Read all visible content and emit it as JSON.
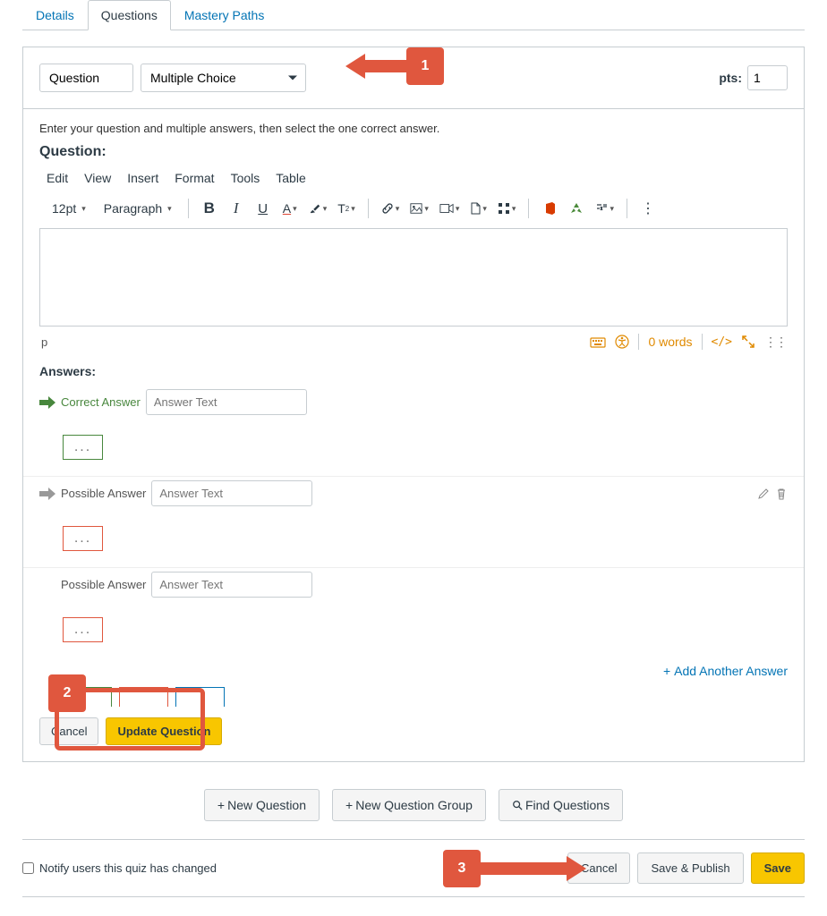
{
  "tabs": {
    "details": "Details",
    "questions": "Questions",
    "mastery": "Mastery Paths"
  },
  "callouts": {
    "c1": "1",
    "c2": "2",
    "c3": "3"
  },
  "question": {
    "name": "Question",
    "type": "Multiple Choice",
    "pts_label": "pts:",
    "pts_value": "1",
    "instruction": "Enter your question and multiple answers, then select the one correct answer.",
    "heading": "Question:"
  },
  "editor": {
    "menu": {
      "edit": "Edit",
      "view": "View",
      "insert": "Insert",
      "format": "Format",
      "tools": "Tools",
      "table": "Table"
    },
    "fontsize": "12pt",
    "parastyle": "Paragraph",
    "status_path": "p",
    "wordcount": "0 words"
  },
  "answers": {
    "heading": "Answers:",
    "correct": "Correct Answer",
    "possible": "Possible Answer",
    "placeholder": "Answer Text",
    "dots": "...",
    "addAnother": "Add Another Answer"
  },
  "buttons": {
    "cancel": "Cancel",
    "updateQuestion": "Update Question",
    "newQuestion": "New Question",
    "newGroup": "New Question Group",
    "findQuestions": "Find Questions",
    "savePublish": "Save & Publish",
    "save": "Save",
    "notify": "Notify users this quiz has changed"
  }
}
